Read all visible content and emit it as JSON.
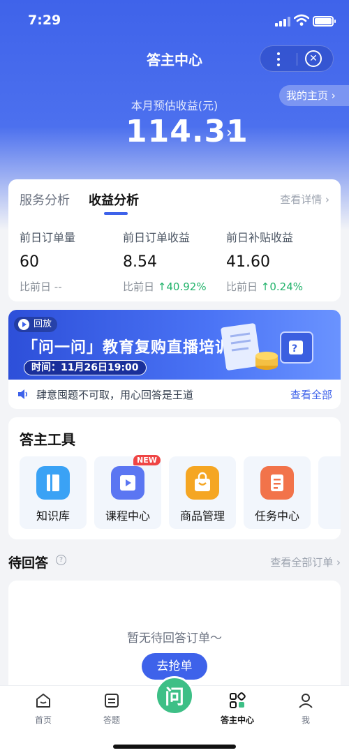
{
  "status_bar": {
    "time": "7:29"
  },
  "header": {
    "title": "答主中心",
    "my_home": "我的主页",
    "earnings_label": "本月预估收益(元)",
    "earnings_value": "114.31"
  },
  "stats": {
    "tabs": [
      "服务分析",
      "收益分析"
    ],
    "active_tab": "收益分析",
    "details": "查看详情",
    "items": [
      {
        "label": "前日订单量",
        "value": "60",
        "compare_prefix": "比前日",
        "compare_value": "--",
        "trend": "none"
      },
      {
        "label": "前日订单收益",
        "value": "8.54",
        "compare_prefix": "比前日",
        "compare_value": "40.92%",
        "trend": "up"
      },
      {
        "label": "前日补贴收益",
        "value": "41.60",
        "compare_prefix": "比前日",
        "compare_value": "0.24%",
        "trend": "up"
      }
    ]
  },
  "banner": {
    "replay": "回放",
    "title": "「问一问」教育复购直播培训",
    "time": "时间：11月26日19:00",
    "notice": "肆意囤题不可取，用心回答是王道",
    "see_all": "查看全部"
  },
  "tools": {
    "heading": "答主工具",
    "items": [
      {
        "label": "知识库",
        "icon": "book-icon",
        "color": "#3aa2f5"
      },
      {
        "label": "课程中心",
        "icon": "video-icon",
        "color": "#5b76f2",
        "badge": "NEW"
      },
      {
        "label": "商品管理",
        "icon": "bag-icon",
        "color": "#f5a623"
      },
      {
        "label": "任务中心",
        "icon": "task-icon",
        "color": "#f2734a"
      }
    ]
  },
  "pending": {
    "heading": "待回答",
    "all_orders": "查看全部订单",
    "empty_message": "暂无待回答订单～",
    "grab_button": "去抢单"
  },
  "tabbar": {
    "items": [
      "首页",
      "答题",
      "问",
      "答主中心",
      "我"
    ],
    "active": "答主中心"
  }
}
